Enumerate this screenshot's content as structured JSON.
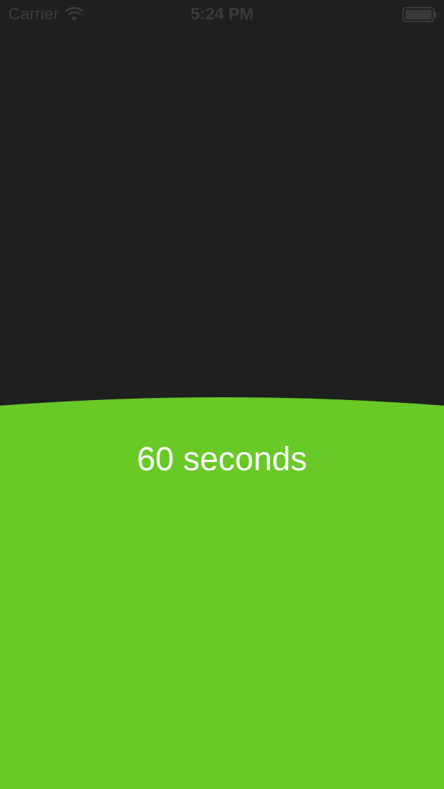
{
  "status_bar": {
    "carrier": "Carrier",
    "time": "5:24 PM",
    "wifi_icon": "wifi-icon",
    "battery_icon": "battery-icon"
  },
  "timer": {
    "label": "60 seconds"
  },
  "colors": {
    "background": "#1f1f1f",
    "fill": "#68c927",
    "status_text": "#3a3a3a",
    "timer_text": "#ffffff"
  }
}
